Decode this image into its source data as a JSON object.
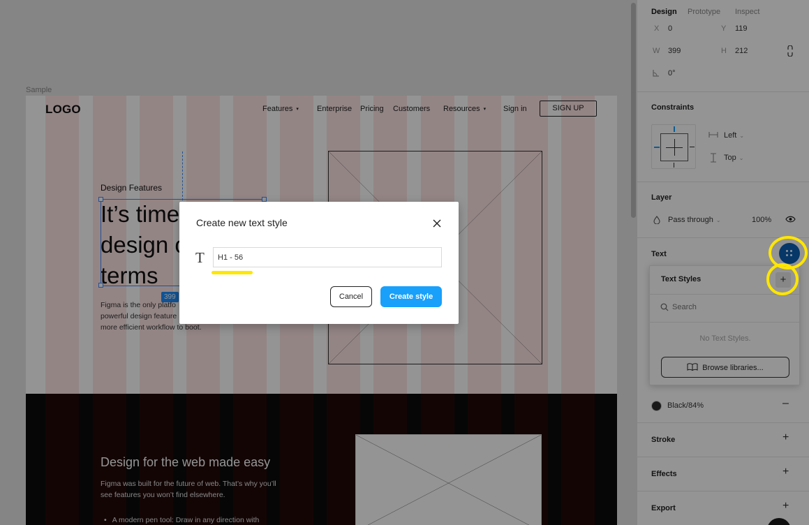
{
  "canvas": {
    "frame_label": "Sample",
    "nav": {
      "logo": "LOGO",
      "links": [
        {
          "label": "Features",
          "caret": "▾"
        },
        {
          "label": "Enterprise"
        },
        {
          "label": "Pricing"
        },
        {
          "label": "Customers"
        },
        {
          "label": "Resources",
          "caret": "▾"
        },
        {
          "label": "Sign in"
        }
      ],
      "signup_label": "SIGN UP"
    },
    "hero": {
      "eyebrow": "Design Features",
      "headline_lines": [
        "It’s time",
        "design c",
        "terms"
      ],
      "dimension_badge": "399",
      "body_lines": [
        "Figma is the only platfo",
        "powerful design feature",
        "more efficient workflow to boot."
      ]
    },
    "dark_section": {
      "title": "Design for the web made easy",
      "body_lines": [
        "Figma was built for the future of web. That’s why you’ll",
        "see features you won’t find elsewhere."
      ],
      "bullet": "A modern pen tool: Draw in any direction with"
    }
  },
  "modal": {
    "title": "Create new text style",
    "input_value": "H1 - 56",
    "cancel_label": "Cancel",
    "create_label": "Create style",
    "highlight_color": "#ffe600"
  },
  "panel": {
    "tabs": [
      "Design",
      "Prototype",
      "Inspect"
    ],
    "position": {
      "x_label": "X",
      "x_value": "0",
      "y_label": "Y",
      "y_value": "119",
      "w_label": "W",
      "w_value": "399",
      "h_label": "H",
      "h_value": "212",
      "rotation_value": "0°"
    },
    "constraints": {
      "title": "Constraints",
      "horizontal": "Left",
      "vertical": "Top"
    },
    "layer": {
      "title": "Layer",
      "blend_mode": "Pass through",
      "opacity": "100%"
    },
    "text": {
      "title": "Text"
    },
    "text_styles_popover": {
      "title": "Text Styles",
      "search_placeholder": "Search",
      "empty_message": "No Text Styles.",
      "browse_label": "Browse libraries..."
    },
    "fill": {
      "name": "Black/84%",
      "swatch_color": "#2b2b2b"
    },
    "sections": {
      "stroke": "Stroke",
      "effects": "Effects",
      "export": "Export"
    },
    "accent_color": "#18a0fb"
  }
}
